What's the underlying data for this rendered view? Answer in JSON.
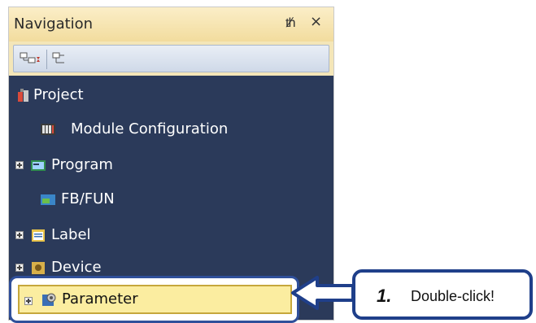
{
  "panel": {
    "title": "Navigation",
    "pin_icon": "pin-icon",
    "close_icon": "close-icon",
    "toolbar": [
      {
        "icon": "expand-tree-icon"
      },
      {
        "icon": "collapse-tree-icon"
      }
    ]
  },
  "tree": {
    "items": [
      {
        "label": "Project",
        "icon": "project-icon"
      },
      {
        "label": "Module Configuration",
        "icon": "module-configuration-icon"
      },
      {
        "label": "Program",
        "icon": "program-icon"
      },
      {
        "label": "FB/FUN",
        "icon": "fb-fun-icon"
      },
      {
        "label": "Label",
        "icon": "label-icon"
      },
      {
        "label": "Device",
        "icon": "device-icon"
      },
      {
        "label": "Parameter",
        "icon": "parameter-icon"
      }
    ]
  },
  "callout": {
    "step": "1.",
    "text": "Double-click!"
  },
  "colors": {
    "tree_bg": "#2b3a5a",
    "highlight": "#fbeda0",
    "callout_border": "#1f3f8a"
  }
}
